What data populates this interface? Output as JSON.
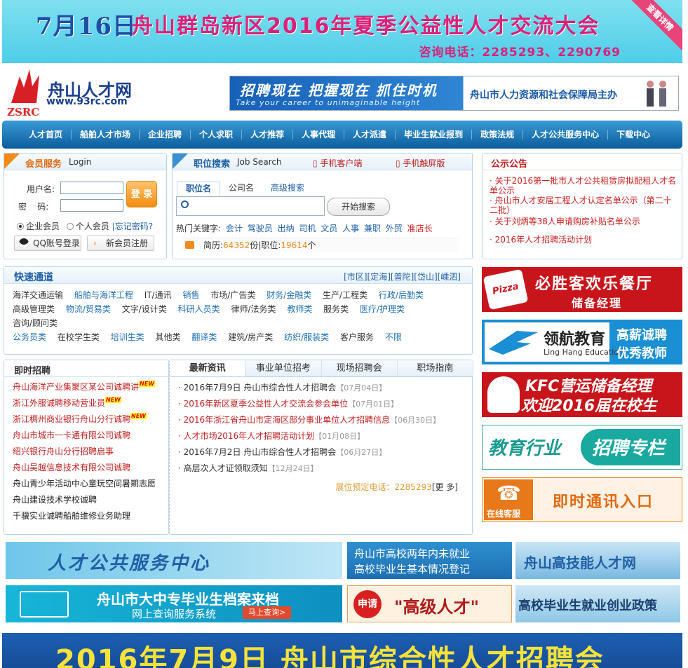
{
  "top_banner": {
    "date": "7月16日",
    "title": "舟山群岛新区2016年夏季公益性人才交流大会",
    "phone": "咨询电话：2285293、2290769",
    "ribbon": "查看详情"
  },
  "logo": {
    "name": "舟山人才网",
    "url": "www.93rc.com",
    "abbr": "ZSRC"
  },
  "slogan": {
    "line1": "招聘现在  把握现在  抓住时机",
    "line2": "Take your career to unimaginable height",
    "org": "舟山市人力资源和社会保障局主办"
  },
  "nav": {
    "items": [
      "人才首页",
      "船舶人才市场",
      "企业招聘",
      "个人求职",
      "人才推荐",
      "人事代理",
      "人才派遣",
      "毕业生就业报到",
      "政策法规",
      "人才公共服务中心",
      "下载中心"
    ]
  },
  "member": {
    "title": "会员服务",
    "title_en": "Login",
    "username_label": "用户名:",
    "password_label": "密    码:",
    "login_button": "登 录",
    "radio_company": "企业会员",
    "radio_person": "个人会员",
    "forgot": "忘记密码?",
    "qq_login": "QQ账号登录",
    "register": "新会员注册"
  },
  "job_search": {
    "title": "职位搜索",
    "title_en": "Job Search",
    "mobile_client": "手机客户端",
    "mobile_touch": "手机触屏版",
    "tabs": [
      "职位名",
      "公司名",
      "高级搜索"
    ],
    "search_button": "开始搜索",
    "hot_label": "热门关键字:",
    "hot_keywords": [
      "会计",
      "驾驶员",
      "出纳",
      "司机",
      "文员",
      "人事",
      "兼职",
      "外贸"
    ],
    "hot_red": "准店长",
    "resume_label": "简历:",
    "resume_count": "64352",
    "resume_unit": "份",
    "job_label": "|职位:",
    "job_count": "19614",
    "job_unit": "个"
  },
  "notice": {
    "title": "公示公告",
    "items": [
      "· 关于2016第一批市人才公共租赁房拟配租人才名单公示",
      "· 舟山市人才安居工程人才认定名单公示（第二十二批）",
      "· 关于刘炳等38人申请购房补贴名单公示",
      "· 2016年人才招聘活动计划"
    ]
  },
  "quick": {
    "title": "快速通道",
    "regions": "[市区][定海][普陀][岱山][嵊泗]",
    "row1": [
      "海洋交通运输",
      "船舶与海洋工程",
      "IT/通讯",
      "销售",
      "市场/广告类",
      "财务/金融类",
      "生产/工程类",
      "行政/后勤类"
    ],
    "row2": [
      "高级管理类",
      "物流/贸易类",
      "文字/设计类",
      "科研人员类",
      "律师/法务类",
      "教师类",
      "服务类",
      "医疗/护理类",
      "咨询/顾问类"
    ],
    "row3": [
      "公务员类",
      "在校学生类",
      "培训生类",
      "其他类",
      "翻译类",
      "建筑/房产类",
      "纺织/服装类",
      "客户服务",
      "不限"
    ]
  },
  "instant_jobs": {
    "title": "即时招聘",
    "new_badge": "NEW",
    "items": [
      "舟山海洋产业集聚区某公司诚聘讲",
      "浙江外服诚聘移动营业员",
      "浙江稠州商业银行舟山分行诚聘",
      "舟山市城市一卡通有限公司诚聘",
      "绍兴银行舟山分行招聘启事",
      "舟山吴越信息技术有限公司诚聘",
      "舟山青少年活动中心童玩空间暑期志愿",
      "舟山建设技术学校诚聘",
      "千骥实业诚聘船舶维修业务助理"
    ]
  },
  "news": {
    "tabs": [
      "最新资讯",
      "事业单位招考",
      "现场招聘会",
      "职场指南"
    ],
    "items": [
      {
        "text": "· 2016年7月9日  舟山市综合性人才招聘会",
        "date": "【07月04日】"
      },
      {
        "text": "· 2016年新区夏季公益性人才交流会参会单位",
        "date": "【07月01日】"
      },
      {
        "text": "· 2016年浙江省舟山市定海区部分事业单位人才招聘信息",
        "date": "【06月30日】"
      },
      {
        "text": "· 人才市场2016年人才招聘活动计划",
        "date": "【01月08日】"
      },
      {
        "text": "· 2016年7月2日  舟山市综合性人才招聘会",
        "date": "【06月27日】"
      },
      {
        "text": "· 高层次人才证领取须知",
        "date": "【12月24日】"
      }
    ],
    "booking": "展位预定电话：2285293",
    "more": "[更 多]"
  },
  "right_ads": {
    "pizza": {
      "line1": "必胜客欢乐餐厅",
      "line2": "储备经理",
      "brand": "Pizza Hut"
    },
    "linghang": {
      "name": "领航教育",
      "en": "Ling Hang Education",
      "line1": "高薪诚聘",
      "line2": "优秀教师"
    },
    "kfc": {
      "line1": "KFC营运储备经理",
      "line2": "欢迎2016届在校生"
    },
    "edu": {
      "left": "教育行业",
      "right": "招聘专栏"
    },
    "chat": {
      "line": "即时通讯入口",
      "tag": "在线客服"
    }
  },
  "bottom": {
    "b1": "人才公共服务中心",
    "b2_line1": "舟山市高校两年内未就业",
    "b2_line2": "高校毕业生基本情况登记",
    "b3": "舟山高技能人才网",
    "b4_line1": "舟山市大中专毕业生档案来档",
    "b4_line2": "网上查询服务系统",
    "b4_btn": "马上查询>",
    "b5_tag": "申请",
    "b5": "\"高级人才\"",
    "b6": "高校毕业生就业创业政策",
    "big": "2016年7月9日  舟山市综合性人才招聘会"
  },
  "colors": {
    "brand_blue": "#0c5c9c",
    "accent_orange": "#f08a1c",
    "link_red": "#c02020"
  }
}
